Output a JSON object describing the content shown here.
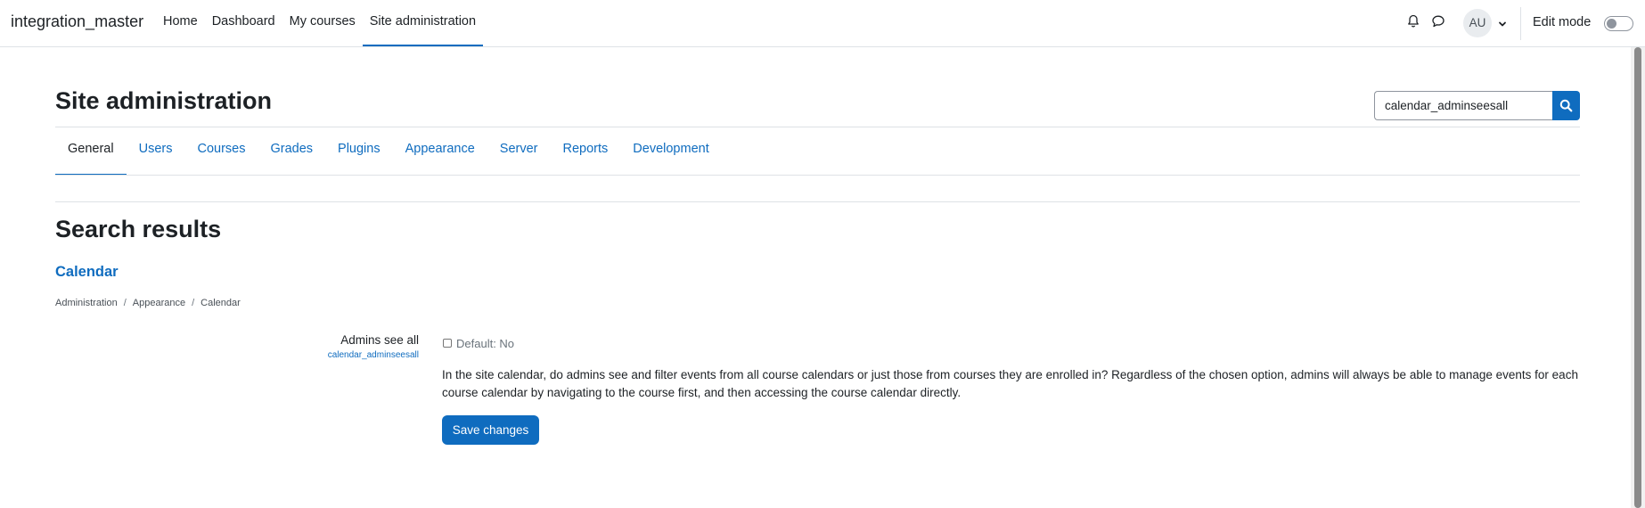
{
  "navbar": {
    "brand": "integration_master",
    "items": [
      {
        "label": "Home"
      },
      {
        "label": "Dashboard"
      },
      {
        "label": "My courses"
      },
      {
        "label": "Site administration"
      }
    ],
    "active_item": "Site administration",
    "avatar_initials": "AU",
    "edit_mode_label": "Edit mode",
    "edit_mode_on": false,
    "icons": [
      "bell-icon",
      "chat-icon",
      "chevron-down-icon"
    ]
  },
  "header": {
    "title": "Site administration",
    "search_value": "calendar_adminseesall"
  },
  "tabs": [
    {
      "label": "General"
    },
    {
      "label": "Users"
    },
    {
      "label": "Courses"
    },
    {
      "label": "Grades"
    },
    {
      "label": "Plugins"
    },
    {
      "label": "Appearance"
    },
    {
      "label": "Server"
    },
    {
      "label": "Reports"
    },
    {
      "label": "Development"
    }
  ],
  "active_tab": "General",
  "results": {
    "title": "Search results",
    "section": "Calendar",
    "breadcrumb": [
      "Administration",
      "Appearance",
      "Calendar"
    ],
    "breadcrumb_separator": "/",
    "setting": {
      "label": "Admins see all",
      "key": "calendar_adminseesall",
      "checked": false,
      "default_text": "Default: No",
      "description": "In the site calendar, do admins see and filter events from all course calendars or just those from courses they are enrolled in? Regardless of the chosen option, admins will always be able to manage events for each course calendar by navigating to the course first, and then accessing the course calendar directly."
    },
    "save_label": "Save changes"
  },
  "colors": {
    "accent": "#0f6cbf",
    "text": "#1d2125",
    "border": "#dee2e6"
  }
}
